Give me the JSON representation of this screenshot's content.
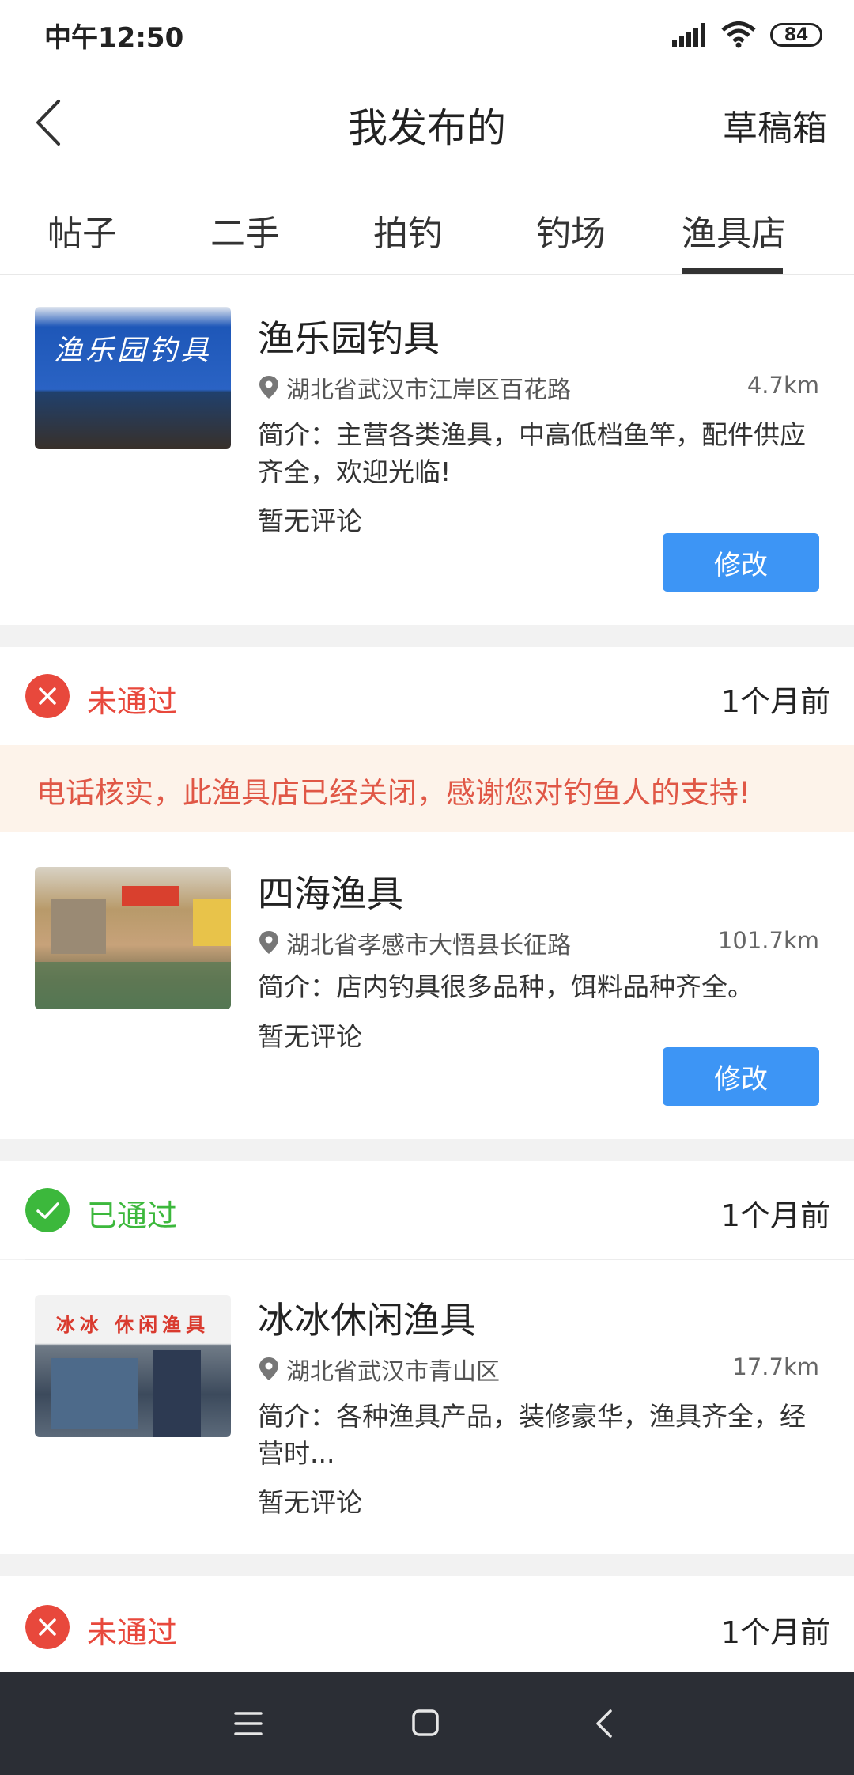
{
  "status_bar": {
    "time": "中午12:50",
    "battery": "84"
  },
  "header": {
    "title": "我发布的",
    "drafts": "草稿箱"
  },
  "tabs": [
    {
      "label": "帖子"
    },
    {
      "label": "二手"
    },
    {
      "label": "拍钓"
    },
    {
      "label": "钓场"
    },
    {
      "label": "渔具店"
    }
  ],
  "active_tab": "渔具店",
  "shops": [
    {
      "name": "渔乐园钓具",
      "address": "湖北省武汉市江岸区百花路",
      "distance": "4.7km",
      "intro": "简介：主营各类渔具，中高低档鱼竿，配件供应齐全，欢迎光临!",
      "comments": "暂无评论",
      "edit_label": "修改",
      "sign_text": "渔乐园钓具"
    },
    {
      "status": "未通过",
      "time_ago": "1个月前",
      "notice": "电话核实，此渔具店已经关闭，感谢您对钓鱼人的支持!",
      "name": "四海渔具",
      "address": "湖北省孝感市大悟县长征路",
      "distance": "101.7km",
      "intro": "简介：店内钓具很多品种，饵料品种齐全。",
      "comments": "暂无评论",
      "edit_label": "修改"
    },
    {
      "status": "已通过",
      "time_ago": "1个月前",
      "name": "冰冰休闲渔具",
      "address": "湖北省武汉市青山区",
      "distance": "17.7km",
      "intro": "简介：各种渔具产品，装修豪华，渔具齐全，经营时...",
      "comments": "暂无评论",
      "sign_text": "冰冰 休闲渔具"
    },
    {
      "status": "未通过",
      "time_ago": "1个月前"
    }
  ],
  "colors": {
    "rejected": "#e8483c",
    "approved": "#3cb83c",
    "button": "#3d95f5",
    "notice_bg": "#fdf3ea"
  },
  "icons": [
    "signal-icon",
    "wifi-icon",
    "battery-icon",
    "back-arrow-icon",
    "location-pin-icon",
    "rejected-x-icon",
    "approved-check-icon",
    "menu-icon",
    "home-icon",
    "nav-back-icon"
  ]
}
